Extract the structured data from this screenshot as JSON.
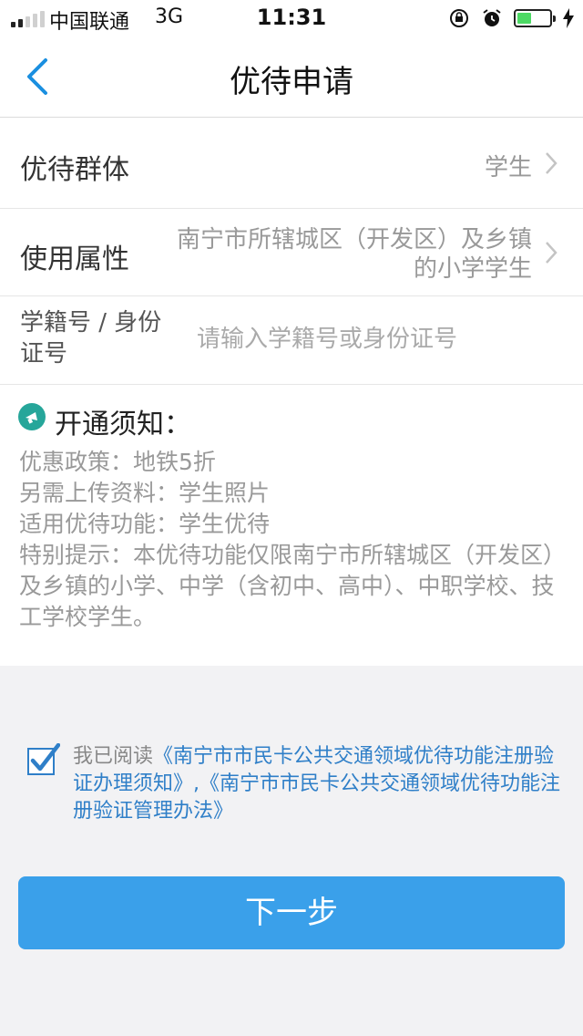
{
  "status_bar": {
    "carrier": "中国联通",
    "network": "3G",
    "time": "11:31",
    "battery_level": 0.45,
    "battery_color": "#4cd964"
  },
  "nav": {
    "title": "优待申请",
    "back_icon": "chevron-left-icon",
    "accent_color": "#1a8fe0"
  },
  "form": {
    "group": {
      "label": "优待群体",
      "value": "学生"
    },
    "attribute": {
      "label": "使用属性",
      "value": "南宁市所辖城区（开发区）及乡镇的小学学生"
    },
    "id_field": {
      "label": "学籍号 / 身份证号",
      "placeholder": "请输入学籍号或身份证号",
      "value": ""
    }
  },
  "notice": {
    "icon": "megaphone-icon",
    "title": "开通须知：",
    "lines": [
      "优惠政策：地铁5折",
      "另需上传资料：学生照片",
      "适用优待功能：学生优待",
      "特别提示：本优待功能仅限南宁市所辖城区（开发区）及乡镇的小学、中学（含初中、高中）、中职学校、技工学校学生。"
    ]
  },
  "agreement": {
    "checked": true,
    "prefix": "我已阅读",
    "link1": "《南宁市市民卡公共交通领域优待功能注册验证办理须知》",
    "separator": ",",
    "link2": "《南宁市市民卡公共交通领域优待功能注册验证管理办法》"
  },
  "next_button": {
    "label": "下一步",
    "color": "#3aa0ea"
  }
}
